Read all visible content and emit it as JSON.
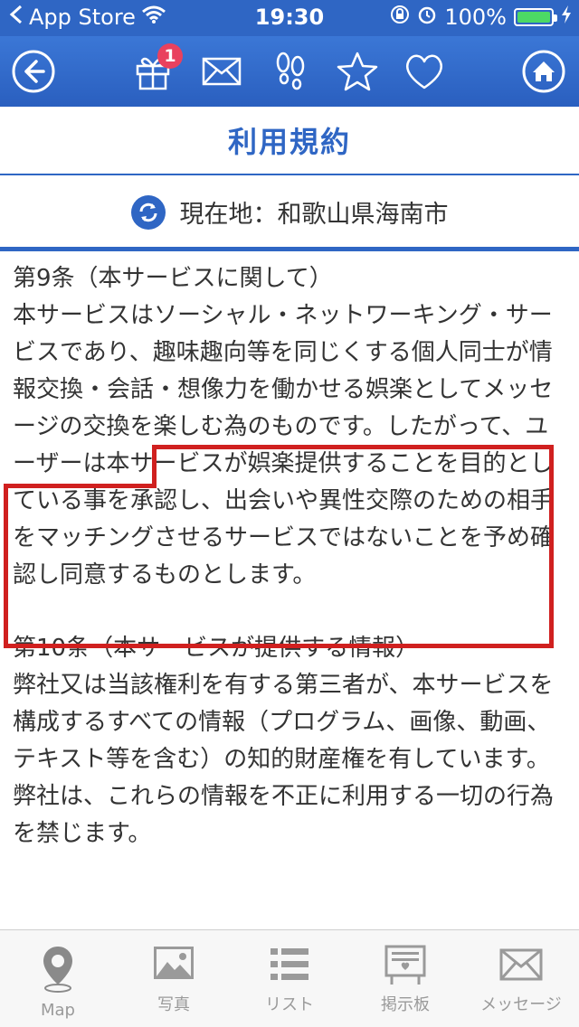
{
  "status_bar": {
    "carrier": "App Store",
    "time": "19:30",
    "battery_percent": "100%",
    "battery_level": 1.0
  },
  "nav": {
    "gift_badge": "1",
    "icons": [
      "back-arrow-icon",
      "gift-icon",
      "mail-icon",
      "footprints-icon",
      "star-icon",
      "heart-icon",
      "home-icon"
    ]
  },
  "page": {
    "title": "利用規約",
    "location": "現在地：和歌山県海南市"
  },
  "terms": {
    "article9_heading": "第9条（本サービスに関して）",
    "article9_body_1": "本サービスはソーシャル・ネットワーキング・サービスであり、趣味趣向等を同じくする個人同士が情報交換・会話・想像力を働かせる娯楽としてメッセージの交換を楽しむ為のものです。したがって、",
    "article9_body_2": "ユーザーは本サービスが娯楽提供することを目的としている事を承認し、出会いや異性交際のための相手をマッチングさせるサービスではないことを予め確認し同意するものとします。",
    "article10_heading": "第10条（本サービスが提供する情報）",
    "article10_body_1": "弊社又は当該権利を有する第三者が、本サービスを構成するすべての情報（プログラム、画像、動画、テキスト等を含む）の知的財産権を有しています。",
    "article10_body_2": "弊社は、これらの情報を不正に利用する一切の行為を禁じます。"
  },
  "tab_bar": {
    "tabs": [
      {
        "label": "Map",
        "icon": "map-pin-icon"
      },
      {
        "label": "写真",
        "icon": "photo-icon"
      },
      {
        "label": "リスト",
        "icon": "list-icon"
      },
      {
        "label": "掲示板",
        "icon": "bulletin-board-icon"
      },
      {
        "label": "メッセージ",
        "icon": "message-icon"
      }
    ]
  }
}
